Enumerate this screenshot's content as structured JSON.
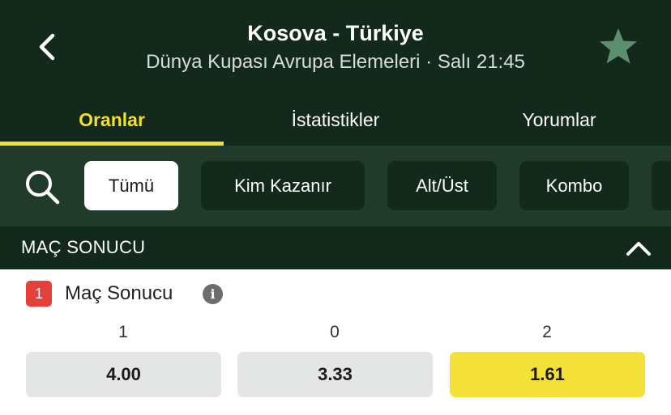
{
  "header": {
    "title": "Kosova - Türkiye",
    "subtitle": "Dünya Kupası Avrupa Elemeleri · Salı 21:45",
    "back_icon": "chevron-left-icon",
    "favorite_icon": "star-icon"
  },
  "tabs": [
    {
      "label": "Oranlar",
      "active": true
    },
    {
      "label": "İstatistikler",
      "active": false
    },
    {
      "label": "Yorumlar",
      "active": false
    }
  ],
  "filters": {
    "search_icon": "search-icon",
    "chips": [
      {
        "label": "Tümü",
        "active": true
      },
      {
        "label": "Kim Kazanır",
        "active": false
      },
      {
        "label": "Alt/Üst",
        "active": false
      },
      {
        "label": "Kombo",
        "active": false
      }
    ]
  },
  "section": {
    "title": "MAÇ SONUCU",
    "collapse_icon": "chevron-up-icon"
  },
  "market": {
    "badge": "1",
    "title": "Maç Sonucu",
    "info_icon": "info-icon",
    "info_glyph": "i",
    "outcomes": [
      {
        "label": "1",
        "odd": "4.00",
        "highlighted": false
      },
      {
        "label": "0",
        "odd": "3.33",
        "highlighted": false
      },
      {
        "label": "2",
        "odd": "1.61",
        "highlighted": true
      }
    ]
  },
  "colors": {
    "header_bg": "#12291b",
    "filter_bg": "#213b2b",
    "accent": "#f2df30",
    "badge_red": "#e6403a",
    "star": "#5b8f6e"
  }
}
